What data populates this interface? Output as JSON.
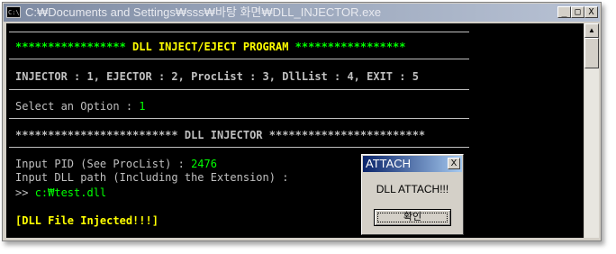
{
  "window": {
    "title": "C:₩Documents and Settings₩sss₩바탕 화면₩DLL_INJECTOR.exe",
    "icon_text": "C:\\",
    "buttons": {
      "minimize": "_",
      "maximize": "□",
      "close": "X"
    }
  },
  "console": {
    "header_stars_left": "*****************",
    "header_title": " DLL INJECT/EJECT PROGRAM ",
    "header_stars_right": "*****************",
    "menu": "INJECTOR : 1, EJECTOR : 2, ProcList : 3, DllList : 4, EXIT : 5",
    "select_label": "Select an Option : ",
    "select_value": "1",
    "section_title": "************************* DLL INJECTOR ************************",
    "pid_label": "Input PID (See ProcList) : ",
    "pid_value": "2476",
    "dll_label": "Input DLL path (Including the Extension) :",
    "dll_prompt": ">> ",
    "dll_value": "c:₩test.dll",
    "result": "[DLL File Injected!!!]"
  },
  "scrollbar": {
    "up_icon": "▲"
  },
  "dialog": {
    "title": "ATTACH",
    "close": "X",
    "message": "DLL ATTACH!!!",
    "ok_label": "확인"
  },
  "colors": {
    "console_bg": "#000000",
    "console_text": "#c0c0c0",
    "highlight_yellow": "#ffff00",
    "highlight_green": "#00ff00",
    "dialog_title_bg": "#0a246a"
  }
}
